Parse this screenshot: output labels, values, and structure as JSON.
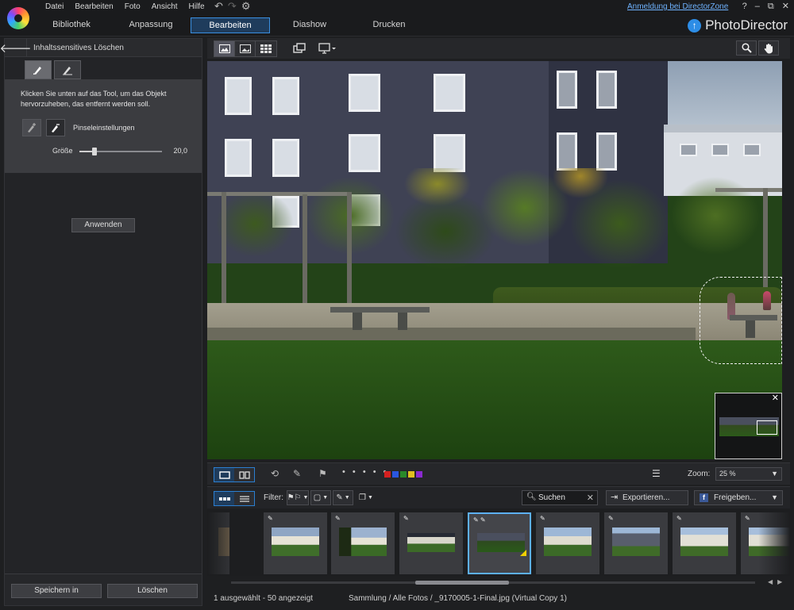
{
  "menu": [
    "Datei",
    "Bearbeiten",
    "Foto",
    "Ansicht",
    "Hilfe"
  ],
  "quick_actions": {
    "undo": "↶",
    "redo": "↷",
    "settings": "⚙"
  },
  "directorzone_link": "Anmeldung bei DirectorZone",
  "window_controls": {
    "help": "?",
    "minimize": "–",
    "restore": "⧉",
    "close": "✕"
  },
  "modes": [
    {
      "label": "Bibliothek",
      "active": false
    },
    {
      "label": "Anpassung",
      "active": false
    },
    {
      "label": "Bearbeiten",
      "active": true
    },
    {
      "label": "Diashow",
      "active": false
    },
    {
      "label": "Drucken",
      "active": false
    }
  ],
  "brand": {
    "name": "PhotoDirector",
    "icon": "↑"
  },
  "left_panel": {
    "back_icon": "🡐",
    "title": "Inhaltssensitives Löschen",
    "hint": "Klicken Sie unten auf das Tool, um das Objekt hervorzuheben, das entfernt werden soll.",
    "brush_label": "Pinseleinstellungen",
    "size_label": "Größe",
    "size_value": "20,0",
    "size_fraction": 0.18,
    "apply_label": "Anwenden",
    "save_label": "Speichern in",
    "delete_label": "Löschen"
  },
  "filmstrip_toolbar": {
    "dots": "• • • • •",
    "color_labels": [
      "#d42020",
      "#2a56e0",
      "#2a8a2a",
      "#e0c020",
      "#8a2ad0"
    ],
    "zoom_label": "Zoom:",
    "zoom_value": "25 %"
  },
  "filter_bar": {
    "filter_label": "Filter:",
    "search_placeholder": "Suchen",
    "export_label": "Exportieren...",
    "share_label": "Freigeben...",
    "fb_letter": "f"
  },
  "status": {
    "selection": "1 ausgewählt - 50 angezeigt",
    "path": "Sammlung / Alle Fotos / _9170005-1-Final.jpg (Virtual Copy 1)"
  },
  "colors": {
    "accent": "#2d8de6",
    "active_tab_bg": "#1f3c5c",
    "link": "#6fb3ff"
  }
}
